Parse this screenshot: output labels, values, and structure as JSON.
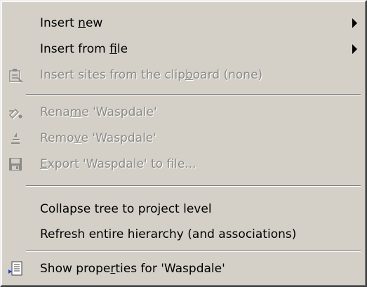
{
  "menu": {
    "items": [
      {
        "pre": "Insert ",
        "key": "n",
        "post": "ew",
        "disabled": false,
        "submenu": true
      },
      {
        "pre": "Insert from ",
        "key": "f",
        "post": "ile",
        "disabled": false,
        "submenu": true
      },
      {
        "pre": "Insert sites from the clip",
        "key": "b",
        "post": "oard (none)",
        "disabled": true,
        "icon": "paste-sites-icon"
      },
      {
        "pre": "Rena",
        "key": "m",
        "post": "e 'Waspdale'",
        "disabled": true,
        "icon": "rename-icon"
      },
      {
        "pre": "Remo",
        "key": "v",
        "post": "e 'Waspdale'",
        "disabled": true,
        "icon": "remove-icon"
      },
      {
        "pre": "",
        "key": "E",
        "post": "xport 'Waspdale' to file...",
        "disabled": true,
        "icon": "export-icon"
      },
      {
        "text": "Collapse tree to project level",
        "disabled": false
      },
      {
        "text": "Refresh entire hierarchy (and associations)",
        "disabled": false
      },
      {
        "pre": "Show prope",
        "key": "r",
        "post": "ties for 'Waspdale'",
        "disabled": false,
        "icon": "properties-icon"
      }
    ]
  }
}
